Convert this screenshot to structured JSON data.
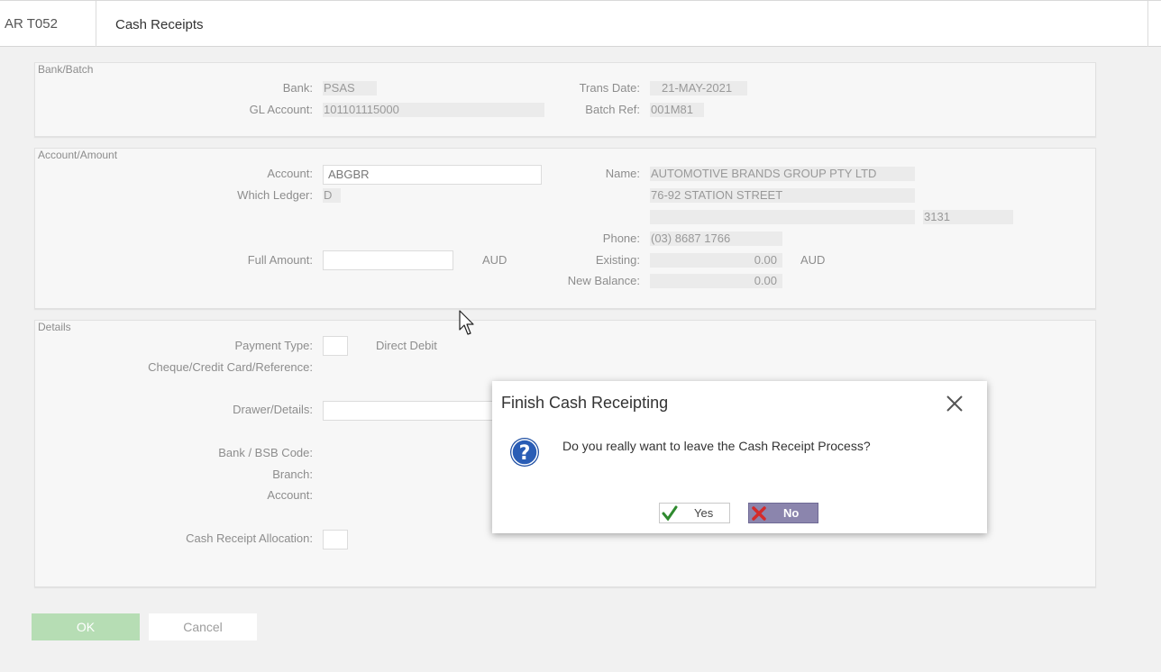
{
  "header": {
    "code": "AR T052",
    "title": "Cash Receipts"
  },
  "bank_batch": {
    "legend": "Bank/Batch",
    "bank_label": "Bank:",
    "bank_value": "PSAS",
    "gl_label": "GL Account:",
    "gl_value": "101101115000",
    "trans_date_label": "Trans Date:",
    "trans_date_value": "21-MAY-2021",
    "batch_ref_label": "Batch Ref:",
    "batch_ref_value": "001M81"
  },
  "account_amount": {
    "legend": "Account/Amount",
    "account_label": "Account:",
    "account_value": "ABGBR",
    "ledger_label": "Which Ledger:",
    "ledger_value": "D",
    "full_amount_label": "Full Amount:",
    "full_amount_value": "",
    "full_amount_currency": "AUD",
    "name_label": "Name:",
    "name_value": "AUTOMOTIVE BRANDS GROUP PTY LTD",
    "address1": "76-92 STATION STREET",
    "address2": "",
    "postcode": "3131",
    "phone_label": "Phone:",
    "phone_value": "(03) 8687 1766",
    "existing_label": "Existing:",
    "existing_value": "0.00",
    "existing_currency": "AUD",
    "new_balance_label": "New Balance:",
    "new_balance_value": "0.00"
  },
  "details": {
    "legend": "Details",
    "payment_type_label": "Payment Type:",
    "payment_type_value": "",
    "payment_type_desc": "Direct Debit",
    "reference_label": "Cheque/Credit Card/Reference:",
    "drawer_label": "Drawer/Details:",
    "drawer_value": "",
    "bsb_label": "Bank / BSB Code:",
    "branch_label": "Branch:",
    "account_label": "Account:",
    "allocation_label": "Cash Receipt Allocation:",
    "allocation_value": ""
  },
  "footer": {
    "ok_label": "OK",
    "cancel_label": "Cancel"
  },
  "dialog": {
    "title": "Finish Cash Receipting",
    "message": "Do you really want to leave the Cash Receipt Process?",
    "yes_label": "Yes",
    "no_label": "No"
  },
  "colors": {
    "ok_button": "#b6ddb4",
    "no_button": "#8b85ad",
    "question_icon": "#1f4fa3"
  }
}
